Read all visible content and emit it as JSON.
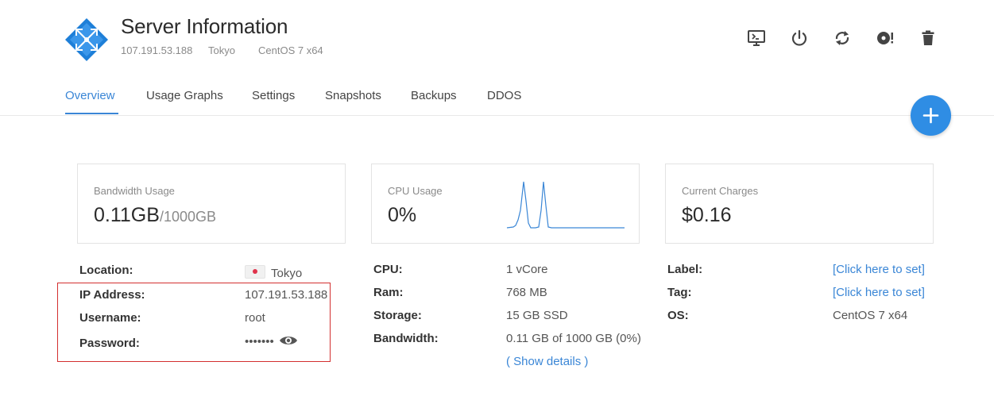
{
  "header": {
    "title": "Server Information",
    "ip": "107.191.53.188",
    "location": "Tokyo",
    "os": "CentOS 7 x64",
    "logo_icon": "vultr-diamond-logo",
    "brand_color": "#2f8de4",
    "actions": [
      {
        "name": "server-console-icon"
      },
      {
        "name": "server-stop-icon"
      },
      {
        "name": "server-restart-icon"
      },
      {
        "name": "server-reinstall-icon"
      },
      {
        "name": "server-destroy-icon"
      }
    ]
  },
  "tabs": [
    "Overview",
    "Usage Graphs",
    "Settings",
    "Snapshots",
    "Backups",
    "DDOS"
  ],
  "active_tab": "Overview",
  "accent_color": "#3a86d6",
  "cards": {
    "bandwidth": {
      "label": "Bandwidth Usage",
      "value": "0.11GB",
      "limit": "/1000GB"
    },
    "cpu": {
      "label": "CPU Usage",
      "value": "0%"
    },
    "charges": {
      "label": "Current Charges",
      "value": "$0.16"
    }
  },
  "details": {
    "location_label": "Location:",
    "location_value": "Tokyo",
    "location_flag": "japan-flag",
    "ip_label": "IP Address:",
    "ip_value": "107.191.53.188",
    "username_label": "Username:",
    "username_value": "root",
    "password_label": "Password:",
    "password_value": "•••••••",
    "cpu_label": "CPU:",
    "cpu_value": "1 vCore",
    "ram_label": "Ram:",
    "ram_value": "768 MB",
    "storage_label": "Storage:",
    "storage_value": "15 GB SSD",
    "bandwidth_label": "Bandwidth:",
    "bandwidth_value": "0.11 GB of 1000 GB (0%)",
    "show_details_open": "( ",
    "show_details": "Show details",
    "show_details_close": " )",
    "label_label": "Label:",
    "label_value": "[Click here to set]",
    "tag_label": "Tag:",
    "tag_value": "[Click here to set]",
    "os_label": "OS:",
    "os_value": "CentOS 7 x64"
  }
}
